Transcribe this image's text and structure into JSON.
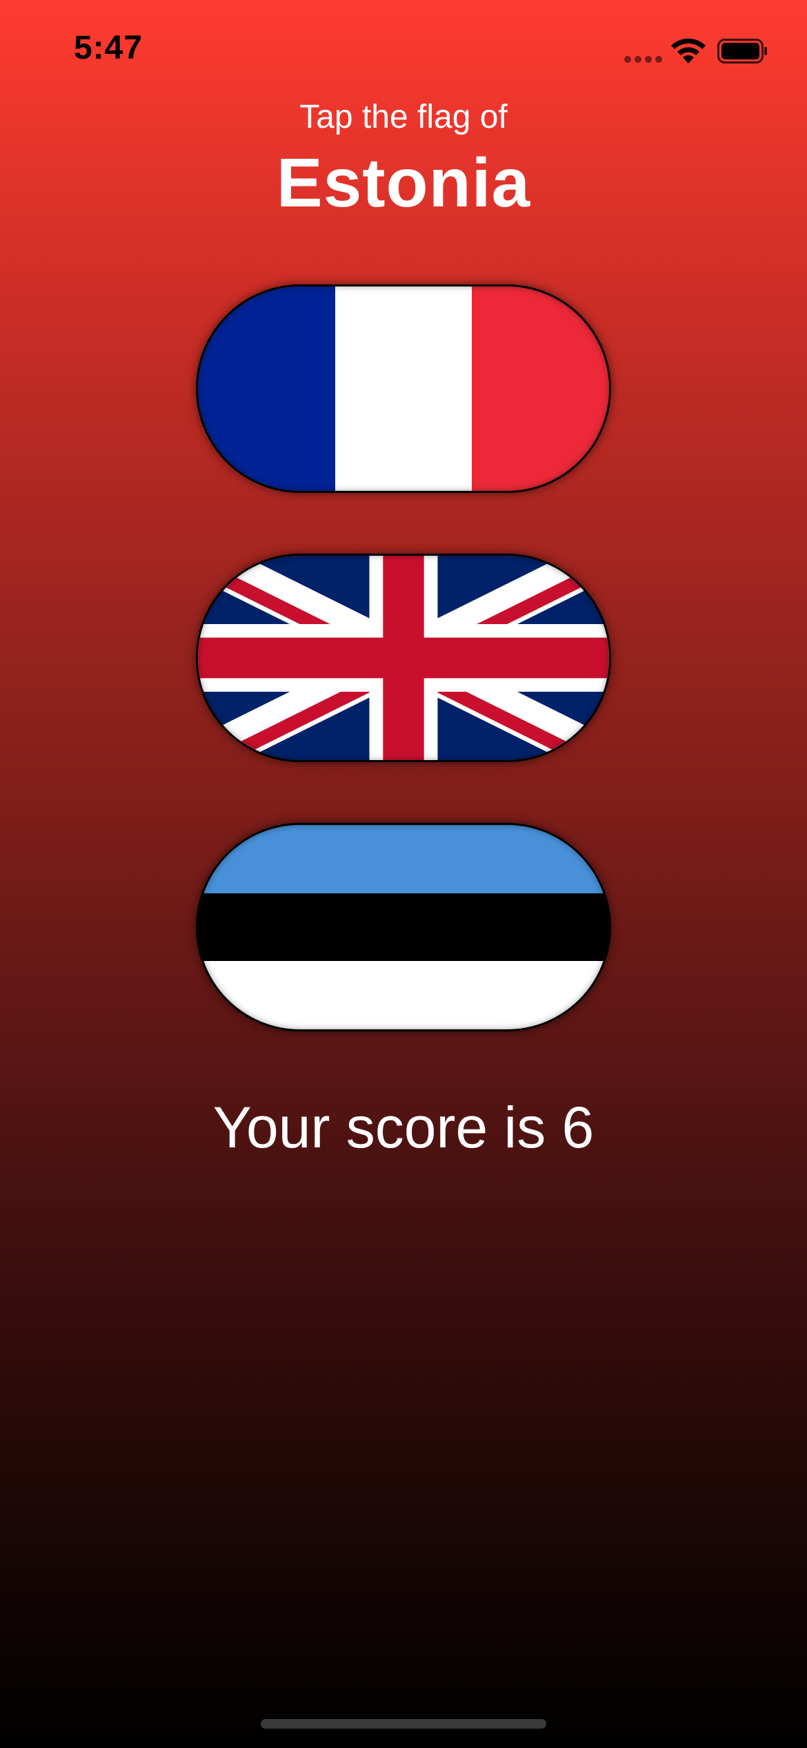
{
  "status_bar": {
    "time": "5:47"
  },
  "prompt": {
    "text": "Tap the flag of",
    "country": "Estonia"
  },
  "flags": [
    {
      "country": "France",
      "icon": "france-flag-icon"
    },
    {
      "country": "UK",
      "icon": "uk-flag-icon"
    },
    {
      "country": "Estonia",
      "icon": "estonia-flag-icon"
    }
  ],
  "score": {
    "text": "Your score is 6"
  },
  "colors": {
    "gradient_top": "#ff3b30",
    "gradient_bottom": "#000000",
    "text": "#ffffff"
  }
}
